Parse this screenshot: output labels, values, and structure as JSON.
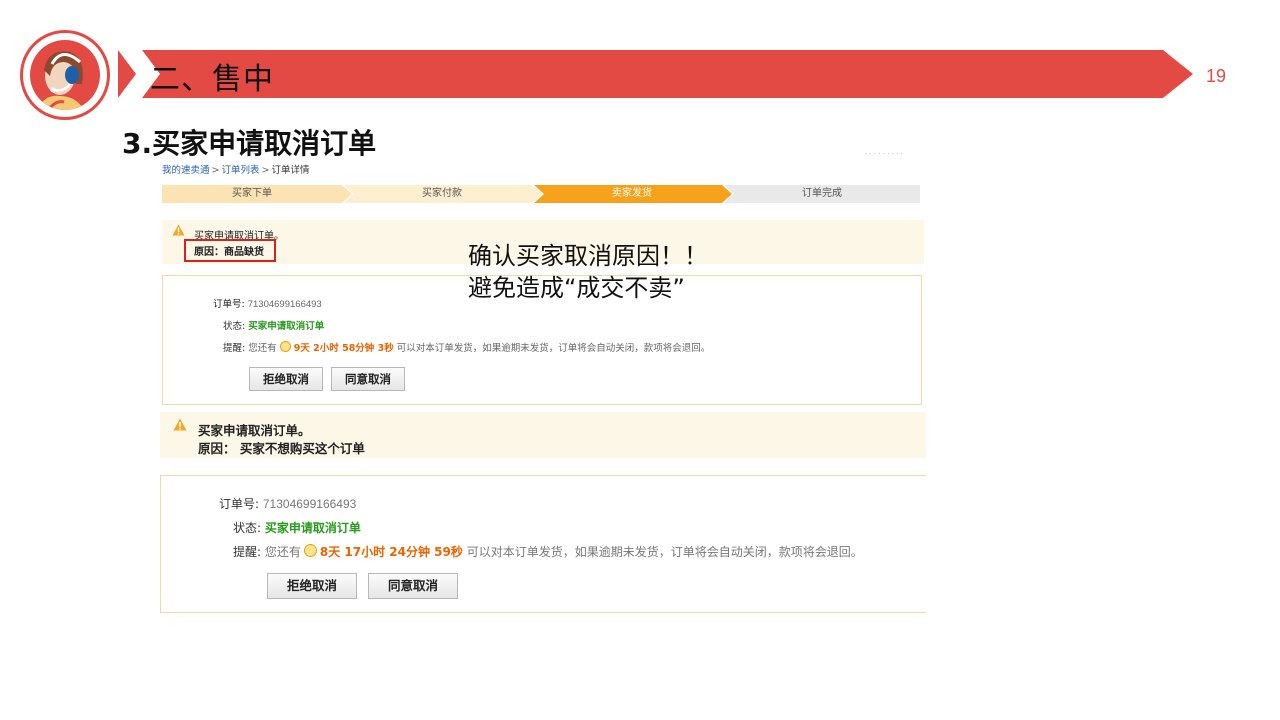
{
  "slide": {
    "section": "二、售中",
    "page_number": "19",
    "subtitle": "3.买家申请取消订单",
    "accent_color": "#e34a44"
  },
  "annotation": {
    "line1": "确认买家取消原因！！",
    "line2": "避免造成“成交不卖”"
  },
  "screenshot": {
    "topright_text": "· · · · · · · · ·",
    "breadcrumb": {
      "item1": "我的速卖通",
      "item2": "订单列表",
      "item3": "订单详情",
      "separator": ">"
    },
    "steps": [
      {
        "label": "买家下单",
        "state": "done"
      },
      {
        "label": "买家付款",
        "state": "done"
      },
      {
        "label": "卖家发货",
        "state": "active"
      },
      {
        "label": "订单完成",
        "state": "todo"
      }
    ],
    "notice_small": {
      "title": "买家申请取消订单。",
      "reason": "原因：商品缺货"
    },
    "order_small": {
      "order_no_label": "订单号:",
      "order_no": "71304699166493",
      "status_label": "状态:",
      "status": "买家申请取消订单",
      "reminder_label": "提醒:",
      "reminder_prefix": "您还有",
      "countdown": "9天 2小时 58分钟 3秒",
      "reminder_suffix": "可以对本订单发货，如果逾期未发货，订单将会自动关闭，款项将会退回。",
      "reject_button": "拒绝取消",
      "agree_button": "同意取消"
    },
    "notice_large": {
      "title": "买家申请取消订单。",
      "reason": "原因：  买家不想购买这个订单"
    },
    "order_large": {
      "order_no_label": "订单号:",
      "order_no": "71304699166493",
      "status_label": "状态:",
      "status": "买家申请取消订单",
      "reminder_label": "提醒:",
      "reminder_prefix": "您还有",
      "countdown": "8天 17小时 24分钟 59秒",
      "reminder_suffix": "可以对本订单发货，如果逾期未发货，订单将会自动关闭，款项将会退回。",
      "reject_button": "拒绝取消",
      "agree_button": "同意取消"
    }
  }
}
